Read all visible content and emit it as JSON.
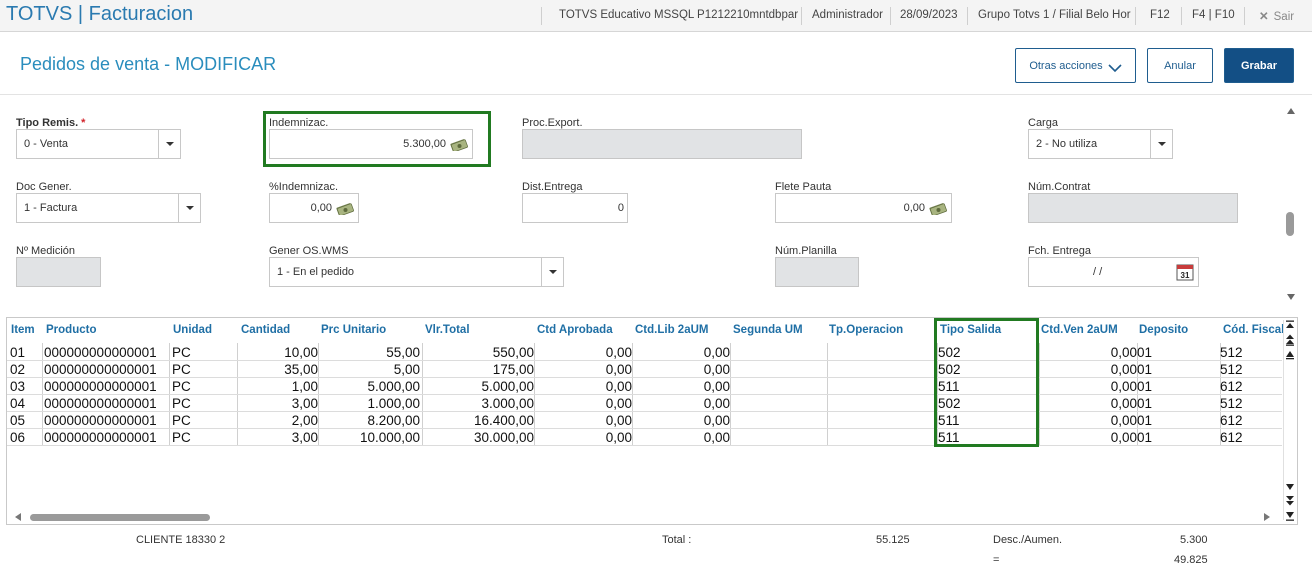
{
  "topbar": {
    "app_title": "TOTVS | Facturacion",
    "environment": "TOTVS Educativo MSSQL P1212210mntdbpar",
    "user": "Administrador",
    "date": "28/09/2023",
    "branch": "Grupo Totvs 1 / Filial Belo Hor",
    "f12": "F12",
    "f4f10": "F4 | F10",
    "exit": "Sair"
  },
  "header": {
    "title": "Pedidos de venta - MODIFICAR",
    "otras_acciones": "Otras acciones",
    "anular": "Anular",
    "grabar": "Grabar"
  },
  "form": {
    "tipo_remis": {
      "label": "Tipo Remis.",
      "required": "*",
      "value": "0 - Venta"
    },
    "indemnizac": {
      "label": "Indemnizac.",
      "value": "5.300,00"
    },
    "proc_export": {
      "label": "Proc.Export.",
      "value": ""
    },
    "carga": {
      "label": "Carga",
      "value": "2 - No utiliza"
    },
    "doc_gener": {
      "label": "Doc Gener.",
      "value": "1 - Factura"
    },
    "pct_indemnizac": {
      "label": "%Indemnizac.",
      "value": "0,00"
    },
    "dist_entrega": {
      "label": "Dist.Entrega",
      "value": "0"
    },
    "flete_pauta": {
      "label": "Flete Pauta",
      "value": "0,00"
    },
    "num_contrat": {
      "label": "Núm.Contrat",
      "value": ""
    },
    "n_medicion": {
      "label": "Nº Medición",
      "value": ""
    },
    "gener_os_wms": {
      "label": "Gener OS.WMS",
      "value": "1 - En el pedido"
    },
    "num_planilla": {
      "label": "Núm.Planilla",
      "value": ""
    },
    "fch_entrega": {
      "label": "Fch. Entrega",
      "value": "/ /"
    }
  },
  "grid": {
    "columns": [
      "Item",
      "Producto",
      "Unidad",
      "Cantidad",
      "Prc Unitario",
      "Vlr.Total",
      "Ctd Aprobada",
      "Ctd.Lib 2aUM",
      "Segunda UM",
      "Tp.Operacion",
      "Tipo Salida",
      "Ctd.Ven 2aUM",
      "Deposito",
      "Cód. Fiscal"
    ],
    "rows": [
      [
        "01",
        "000000000000001",
        "PC",
        "10,00",
        "55,00",
        "550,00",
        "0,00",
        "0,00",
        "",
        "",
        "502",
        "0,00",
        "01",
        "512"
      ],
      [
        "02",
        "000000000000001",
        "PC",
        "35,00",
        "5,00",
        "175,00",
        "0,00",
        "0,00",
        "",
        "",
        "502",
        "0,00",
        "01",
        "512"
      ],
      [
        "03",
        "000000000000001",
        "PC",
        "1,00",
        "5.000,00",
        "5.000,00",
        "0,00",
        "0,00",
        "",
        "",
        "511",
        "0,00",
        "01",
        "612"
      ],
      [
        "04",
        "000000000000001",
        "PC",
        "3,00",
        "1.000,00",
        "3.000,00",
        "0,00",
        "0,00",
        "",
        "",
        "502",
        "0,00",
        "01",
        "512"
      ],
      [
        "05",
        "000000000000001",
        "PC",
        "2,00",
        "8.200,00",
        "16.400,00",
        "0,00",
        "0,00",
        "",
        "",
        "511",
        "0,00",
        "01",
        "612"
      ],
      [
        "06",
        "000000000000001",
        "PC",
        "3,00",
        "10.000,00",
        "30.000,00",
        "0,00",
        "0,00",
        "",
        "",
        "511",
        "0,00",
        "01",
        "612"
      ]
    ]
  },
  "footer": {
    "cliente": "CLIENTE 18330 2",
    "total_label": "Total :",
    "total_value": "55.125",
    "desc_label": "Desc./Aumen.",
    "desc_value": "5.300",
    "eq_label": "=",
    "net_value": "49.825"
  }
}
